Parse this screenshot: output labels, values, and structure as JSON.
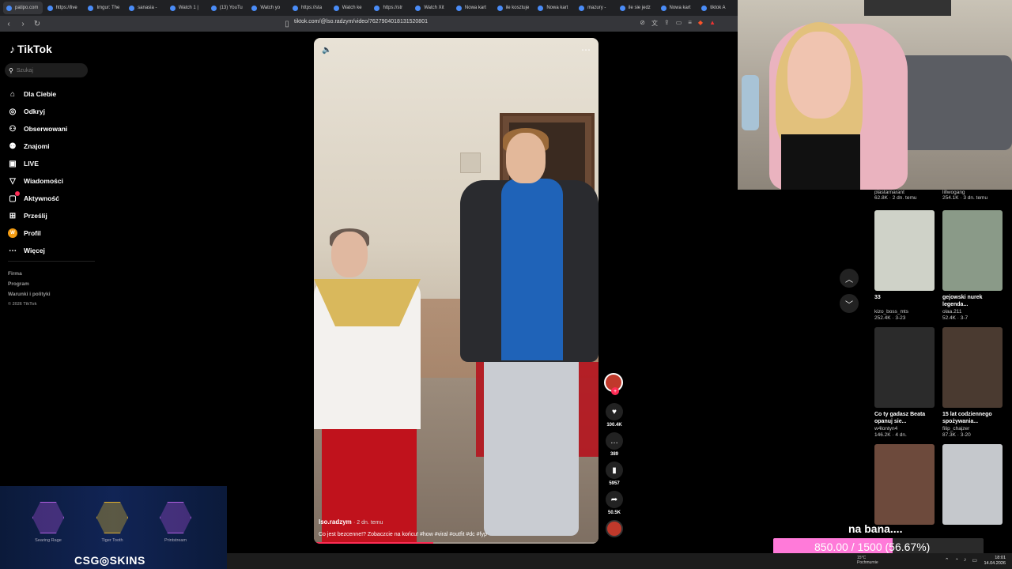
{
  "browser": {
    "tabs": [
      {
        "label": "patipo.com",
        "active": true
      },
      {
        "label": "https://live"
      },
      {
        "label": "Imgur: The"
      },
      {
        "label": "sanasia - "
      },
      {
        "label": "Watch 1 |"
      },
      {
        "label": "(13) YouTu"
      },
      {
        "label": "Watch yo"
      },
      {
        "label": "https://sta"
      },
      {
        "label": "Watch ke"
      },
      {
        "label": "https://str"
      },
      {
        "label": "Watch Xit"
      },
      {
        "label": "Nowa kart"
      },
      {
        "label": "ile kosztuje"
      },
      {
        "label": "Nowa kart"
      },
      {
        "label": "mazury - "
      },
      {
        "label": "ile sie jedz"
      },
      {
        "label": "Nowa kart"
      },
      {
        "label": "tiktok A"
      }
    ],
    "url": "tiktok.com/@lso.radzym/video/7627904018131520801"
  },
  "sidebar": {
    "logo": "TikTok",
    "search_placeholder": "Szukaj",
    "items": [
      {
        "label": "Dla Ciebie",
        "icon": "home-icon"
      },
      {
        "label": "Odkryj",
        "icon": "compass-icon"
      },
      {
        "label": "Obserwowani",
        "icon": "following-icon"
      },
      {
        "label": "Znajomi",
        "icon": "friends-icon"
      },
      {
        "label": "LIVE",
        "icon": "live-icon"
      },
      {
        "label": "Wiadomości",
        "icon": "messages-icon"
      },
      {
        "label": "Aktywność",
        "icon": "activity-icon"
      },
      {
        "label": "Prześlij",
        "icon": "upload-icon"
      },
      {
        "label": "Profil",
        "icon": "profile-avatar"
      },
      {
        "label": "Więcej",
        "icon": "more-icon"
      }
    ],
    "footer": {
      "links": [
        "Firma",
        "Program",
        "Warunki i polityki"
      ],
      "copyright": "© 2026 TikTok"
    }
  },
  "video": {
    "author": "lso.radzym",
    "time": "· 2 dn. temu",
    "description": "Co jest bezcenne!? Zobaczcie na końcu! #how #viral #outfit #dc #fyp",
    "progress": 0.42
  },
  "actions": {
    "likes": "100.4K",
    "comments": "389",
    "saves": "5957",
    "shares": "50.5K"
  },
  "recommendations": {
    "top_meta": [
      {
        "user": "plastarnarant",
        "stats": "62.8K · 2 dn. temu"
      },
      {
        "user": "lillwogang",
        "stats": "254.1K · 3 dn. temu"
      }
    ],
    "cards": [
      {
        "title": "33",
        "user": "kizo_boss_mts",
        "stats": "252.4K · 3-23",
        "color": "#cfd2c8"
      },
      {
        "title": "gejowski nurek legenda...",
        "user": "olaa.211",
        "stats": "52.4K · 3-7",
        "color": "#8a9a88"
      },
      {
        "title": "Co ty gadasz Beata opanuj sie...",
        "user": "w4lontyn4",
        "stats": "146.2K · 4 dn.",
        "color": "#2b2b2b"
      },
      {
        "title": "15 lat codziennego spożywania...",
        "user": "filip_chajzer",
        "stats": "87.3K · 3-20",
        "color": "#4a3a30"
      },
      {
        "title": "",
        "user": "",
        "stats": "",
        "color": "#6d4a3c"
      },
      {
        "title": "",
        "user": "",
        "stats": "",
        "color": "#c5c8cc"
      }
    ]
  },
  "stream_overlay": {
    "chat_text": "na bana....",
    "goal_text": "850.00 / 1500 (56.67%)",
    "goal_fraction": 0.5667,
    "goal_color": "#ff7ad9"
  },
  "csgo_banner": {
    "brand": "CSG",
    "brand_tail": "SKINS",
    "skins": [
      "Searing Rage",
      "Tiger Tooth",
      "Printstream"
    ]
  },
  "taskbar": {
    "weather": "15°C",
    "weather_desc": "Pochmurnie",
    "time": "18:01",
    "date": "14.04.2026"
  }
}
